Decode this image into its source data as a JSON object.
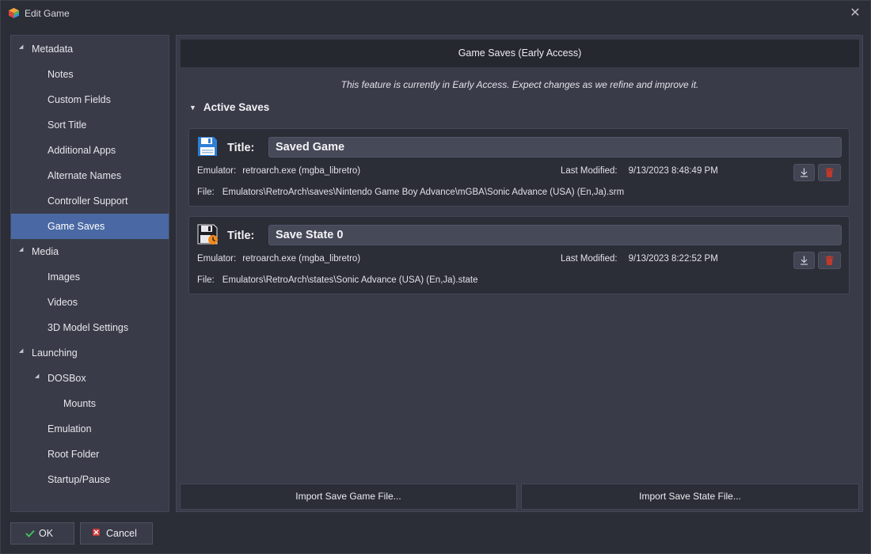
{
  "window": {
    "title": "Edit Game"
  },
  "nav": {
    "items": [
      {
        "label": "Metadata",
        "level": 0,
        "expander": true
      },
      {
        "label": "Notes",
        "level": 1
      },
      {
        "label": "Custom Fields",
        "level": 1
      },
      {
        "label": "Sort Title",
        "level": 1
      },
      {
        "label": "Additional Apps",
        "level": 1
      },
      {
        "label": "Alternate Names",
        "level": 1
      },
      {
        "label": "Controller Support",
        "level": 1
      },
      {
        "label": "Game Saves",
        "level": 1,
        "selected": true
      },
      {
        "label": "Media",
        "level": 0,
        "expander": true
      },
      {
        "label": "Images",
        "level": 1
      },
      {
        "label": "Videos",
        "level": 1
      },
      {
        "label": "3D Model Settings",
        "level": 1
      },
      {
        "label": "Launching",
        "level": 0,
        "expander": true
      },
      {
        "label": "DOSBox",
        "level": 1,
        "expander": true
      },
      {
        "label": "Mounts",
        "level": 2
      },
      {
        "label": "Emulation",
        "level": 1
      },
      {
        "label": "Root Folder",
        "level": 1
      },
      {
        "label": "Startup/Pause",
        "level": 1
      }
    ]
  },
  "main": {
    "header": "Game Saves (Early Access)",
    "notice": "This feature is currently in Early Access. Expect changes as we refine and improve it.",
    "section_title": "Active Saves",
    "saves": [
      {
        "icon": "floppy-disk-icon",
        "title_label": "Title:",
        "title_value": "Saved Game",
        "emulator_label": "Emulator:",
        "emulator": "retroarch.exe (mgba_libretro)",
        "modified_label": "Last Modified:",
        "modified": "9/13/2023 8:48:49 PM",
        "file_label": "File:",
        "file": "Emulators\\RetroArch\\saves\\Nintendo Game Boy Advance\\mGBA\\Sonic Advance (USA) (En,Ja).srm"
      },
      {
        "icon": "floppy-disk-clock-icon",
        "title_label": "Title:",
        "title_value": "Save State 0",
        "emulator_label": "Emulator:",
        "emulator": "retroarch.exe (mgba_libretro)",
        "modified_label": "Last Modified:",
        "modified": "9/13/2023 8:22:52 PM",
        "file_label": "File:",
        "file": "Emulators\\RetroArch\\states\\Sonic Advance (USA) (En,Ja).state"
      }
    ],
    "import_game_label": "Import Save Game File...",
    "import_state_label": "Import Save State File..."
  },
  "footer": {
    "ok_label": "OK",
    "cancel_label": "Cancel"
  },
  "colors": {
    "accent": "#4a69a4",
    "panel": "#393b49",
    "background": "#2b2d37",
    "header": "#262830",
    "ok_green": "#3fbf5a",
    "cancel_red": "#d13b3b",
    "delete_red": "#c0392b",
    "save_blue": "#2f7fd6",
    "clock_orange": "#f08a1c"
  }
}
